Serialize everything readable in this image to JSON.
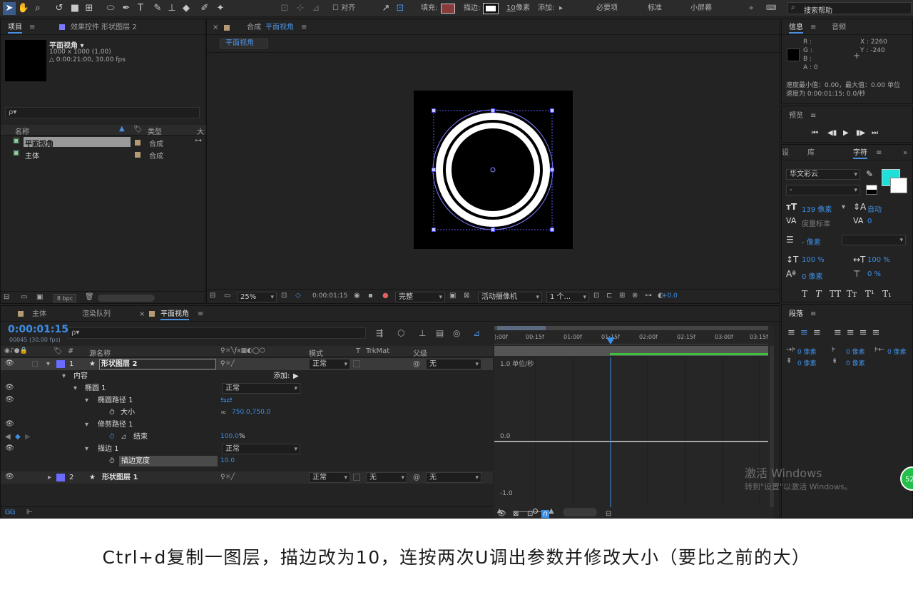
{
  "toolbar": {
    "align_label": "对齐",
    "fill_label": "填充:",
    "stroke_label": "描边:",
    "stroke_value": "10",
    "stroke_unit": "像素",
    "add_label": "添加:",
    "workspaces": [
      "必要项",
      "标准",
      "小屏幕"
    ],
    "search_placeholder": "搜索帮助",
    "colors": {
      "fill": "#8a3a3a",
      "accent": "#3d8ee6"
    }
  },
  "project": {
    "tab_project": "项目",
    "tab_effects": "效果控件 形状图层 2",
    "comp_name": "平面视角 ▾",
    "comp_size": "1000 x 1000 (1.00)",
    "comp_duration": "△ 0:00:21:00, 30.00 fps",
    "search_placeholder": "ρ▾",
    "col_name": "名称",
    "col_type": "类型",
    "col_size": "大",
    "items": [
      {
        "name": "平面视角",
        "type": "合成"
      },
      {
        "name": "主体",
        "type": "合成"
      }
    ],
    "bpc": "8 bpc"
  },
  "comp_panel": {
    "tab_prefix": "合成",
    "tab_name": "平面视角",
    "sub_tab": "平面视角",
    "zoom": "25%",
    "timecode": "0:00:01:15",
    "resolution": "完整",
    "camera": "活动摄像机",
    "views": "1 个...",
    "exposure": "+0.0"
  },
  "info": {
    "tab_info": "信息",
    "tab_audio": "音频",
    "r": "R :",
    "g": "G :",
    "b": "B :",
    "a": "A : 0",
    "x": "X : 2260",
    "y": "Y : -240",
    "speed_line1": "速度最小值：0.00，最大值：0.00 单位",
    "speed_line2": "速度为 0:00:01:15: 0.0/秒"
  },
  "preview": {
    "tab": "预览"
  },
  "character": {
    "tab_effects": "设",
    "tab_library": "库",
    "tab_char": "字符",
    "font": "华文彩云",
    "style": "-",
    "size": "139 像素",
    "leading": "自动",
    "kerning": "度量标准",
    "tracking": "0",
    "stroke": "- 像素",
    "vscale": "100 %",
    "hscale": "100 %",
    "baseline": "0 像素",
    "tsume": "0 %",
    "swatch": "#1fe0d8"
  },
  "paragraph": {
    "tab": "段落",
    "indent_left": "0 像素",
    "indent_first": "0 像素",
    "indent_right": "0 像素",
    "space_before": "0 像素",
    "space_after": "0 像素"
  },
  "timeline": {
    "tab_main": "主体",
    "tab_render": "渲染队列",
    "tab_comp": "平面视角",
    "timecode": "0:00:01:15",
    "frames": "00045 (30.00 fps)",
    "search_placeholder": "ρ▾",
    "col_source": "源名称",
    "col_mode": "模式",
    "col_t": "T",
    "col_trkmat": "TrkMat",
    "col_parent": "父级",
    "layers": [
      {
        "num": "1",
        "name": "形状图层 2",
        "mode": "正常",
        "parent": "无"
      },
      {
        "num": "2",
        "name": "形状图层 1",
        "mode": "正常",
        "trkmat": "无",
        "parent": "无"
      }
    ],
    "contents_label": "内容",
    "add_label": "添加:",
    "ellipse_label": "椭圆 1",
    "ellipse_mode": "正常",
    "ellipse_path_label": "椭圆路径 1",
    "size_label": "大小",
    "size_value": "750.0,750.0",
    "trim_label": "修剪路径 1",
    "end_label": "结束",
    "end_value": "100.0",
    "end_unit": "%",
    "stroke_label": "描边 1",
    "stroke_mode": "正常",
    "stroke_width_label": "描边宽度",
    "stroke_width_value": "10.0",
    "ruler": [
      "):00f",
      "00:15f",
      "01:00f",
      "01:15f",
      "02:00f",
      "02:15f",
      "03:00f",
      "03:15f"
    ],
    "graph_top": "1.0 单位/秒",
    "graph_mid": "0.0",
    "graph_bottom": "-1.0",
    "playhead": "01:15f"
  },
  "watermark": {
    "line1": "激活 Windows",
    "line2": "转到\"设置\"以激活 Windows。",
    "badge": "52"
  },
  "caption": "Ctrl+d复制一图层，描边改为10，连按两次U调出参数并修改大小（要比之前的大）"
}
